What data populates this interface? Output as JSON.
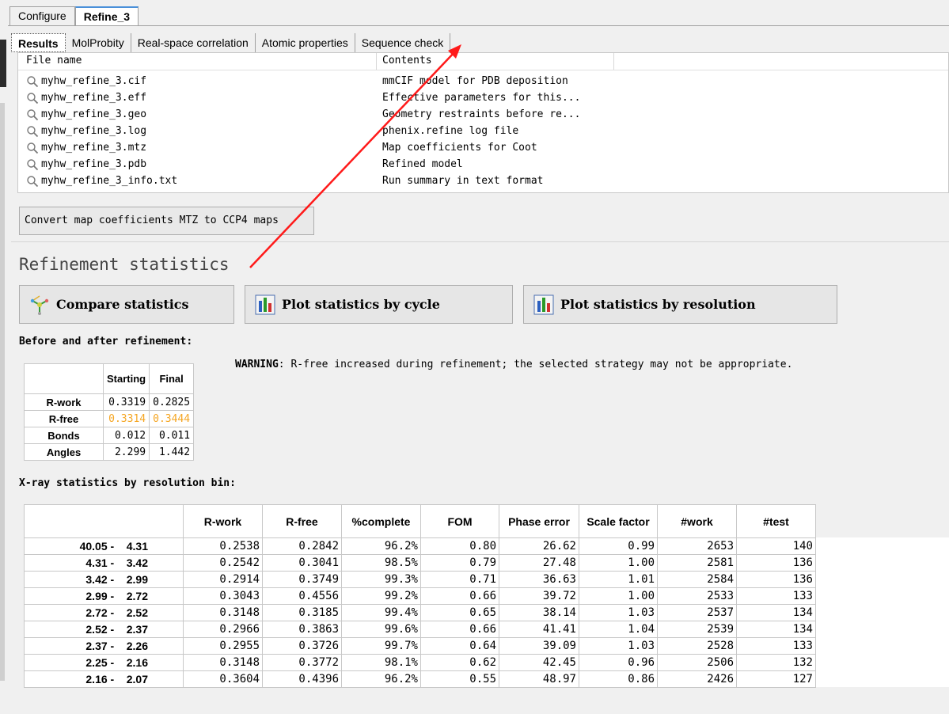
{
  "top_tabs": [
    "Configure",
    "Refine_3"
  ],
  "sub_tabs": [
    "Results",
    "MolProbity",
    "Real-space correlation",
    "Atomic properties",
    "Sequence check"
  ],
  "filelist": {
    "headers": [
      "File name",
      "Contents"
    ],
    "rows": [
      {
        "name": "myhw_refine_3.cif",
        "contents": "mmCIF model for PDB deposition"
      },
      {
        "name": "myhw_refine_3.eff",
        "contents": "Effective parameters for this..."
      },
      {
        "name": "myhw_refine_3.geo",
        "contents": "Geometry restraints before re..."
      },
      {
        "name": "myhw_refine_3.log",
        "contents": "phenix.refine log file"
      },
      {
        "name": "myhw_refine_3.mtz",
        "contents": "Map coefficients for Coot"
      },
      {
        "name": "myhw_refine_3.pdb",
        "contents": "Refined model"
      },
      {
        "name": "myhw_refine_3_info.txt",
        "contents": "Run summary in text format"
      }
    ]
  },
  "convert_button": "Convert map coefficients MTZ to CCP4 maps",
  "section_title": "Refinement statistics",
  "buttons": {
    "compare": "Compare statistics",
    "plot_cycle": "Plot statistics by cycle",
    "plot_resolution": "Plot statistics by resolution"
  },
  "before_after": {
    "heading": "Before and after refinement:",
    "headers": [
      "Starting",
      "Final"
    ],
    "rows": [
      {
        "label": "R-work",
        "start": "0.3319",
        "final": "0.2825"
      },
      {
        "label": "R-free",
        "start": "0.3314",
        "final": "0.3444"
      },
      {
        "label": "Bonds",
        "start": "0.012",
        "final": "0.011"
      },
      {
        "label": "Angles",
        "start": "2.299",
        "final": "1.442"
      }
    ]
  },
  "warning": {
    "label": "WARNING",
    "text": ": R-free increased during refinement; the selected strategy may not be appropriate."
  },
  "xray": {
    "heading": "X-ray statistics by resolution bin:",
    "headers": [
      "R-work",
      "R-free",
      "%complete",
      "FOM",
      "Phase error",
      "Scale factor",
      "#work",
      "#test"
    ],
    "rows": [
      {
        "bin": "40.05 -    4.31",
        "rwork": "0.2538",
        "rfree": "0.2842",
        "complete": "96.2%",
        "fom": "0.80",
        "phase": "26.62",
        "scale": "0.99",
        "work": "2653",
        "test": "140"
      },
      {
        "bin": "4.31 -    3.42",
        "rwork": "0.2542",
        "rfree": "0.3041",
        "complete": "98.5%",
        "fom": "0.79",
        "phase": "27.48",
        "scale": "1.00",
        "work": "2581",
        "test": "136"
      },
      {
        "bin": "3.42 -    2.99",
        "rwork": "0.2914",
        "rfree": "0.3749",
        "complete": "99.3%",
        "fom": "0.71",
        "phase": "36.63",
        "scale": "1.01",
        "work": "2584",
        "test": "136"
      },
      {
        "bin": "2.99 -    2.72",
        "rwork": "0.3043",
        "rfree": "0.4556",
        "complete": "99.2%",
        "fom": "0.66",
        "phase": "39.72",
        "scale": "1.00",
        "work": "2533",
        "test": "133"
      },
      {
        "bin": "2.72 -    2.52",
        "rwork": "0.3148",
        "rfree": "0.3185",
        "complete": "99.4%",
        "fom": "0.65",
        "phase": "38.14",
        "scale": "1.03",
        "work": "2537",
        "test": "134"
      },
      {
        "bin": "2.52 -    2.37",
        "rwork": "0.2966",
        "rfree": "0.3863",
        "complete": "99.6%",
        "fom": "0.66",
        "phase": "41.41",
        "scale": "1.04",
        "work": "2539",
        "test": "134"
      },
      {
        "bin": "2.37 -    2.26",
        "rwork": "0.2955",
        "rfree": "0.3726",
        "complete": "99.7%",
        "fom": "0.64",
        "phase": "39.09",
        "scale": "1.03",
        "work": "2528",
        "test": "133"
      },
      {
        "bin": "2.25 -    2.16",
        "rwork": "0.3148",
        "rfree": "0.3772",
        "complete": "98.1%",
        "fom": "0.62",
        "phase": "42.45",
        "scale": "0.96",
        "work": "2506",
        "test": "132"
      },
      {
        "bin": "2.16 -    2.07",
        "rwork": "0.3604",
        "rfree": "0.4396",
        "complete": "96.2%",
        "fom": "0.55",
        "phase": "48.97",
        "scale": "0.86",
        "work": "2426",
        "test": "127"
      }
    ]
  },
  "colors": {
    "rfree_highlight": "#f5a623",
    "annotation_arrow": "#ff1a1a"
  }
}
